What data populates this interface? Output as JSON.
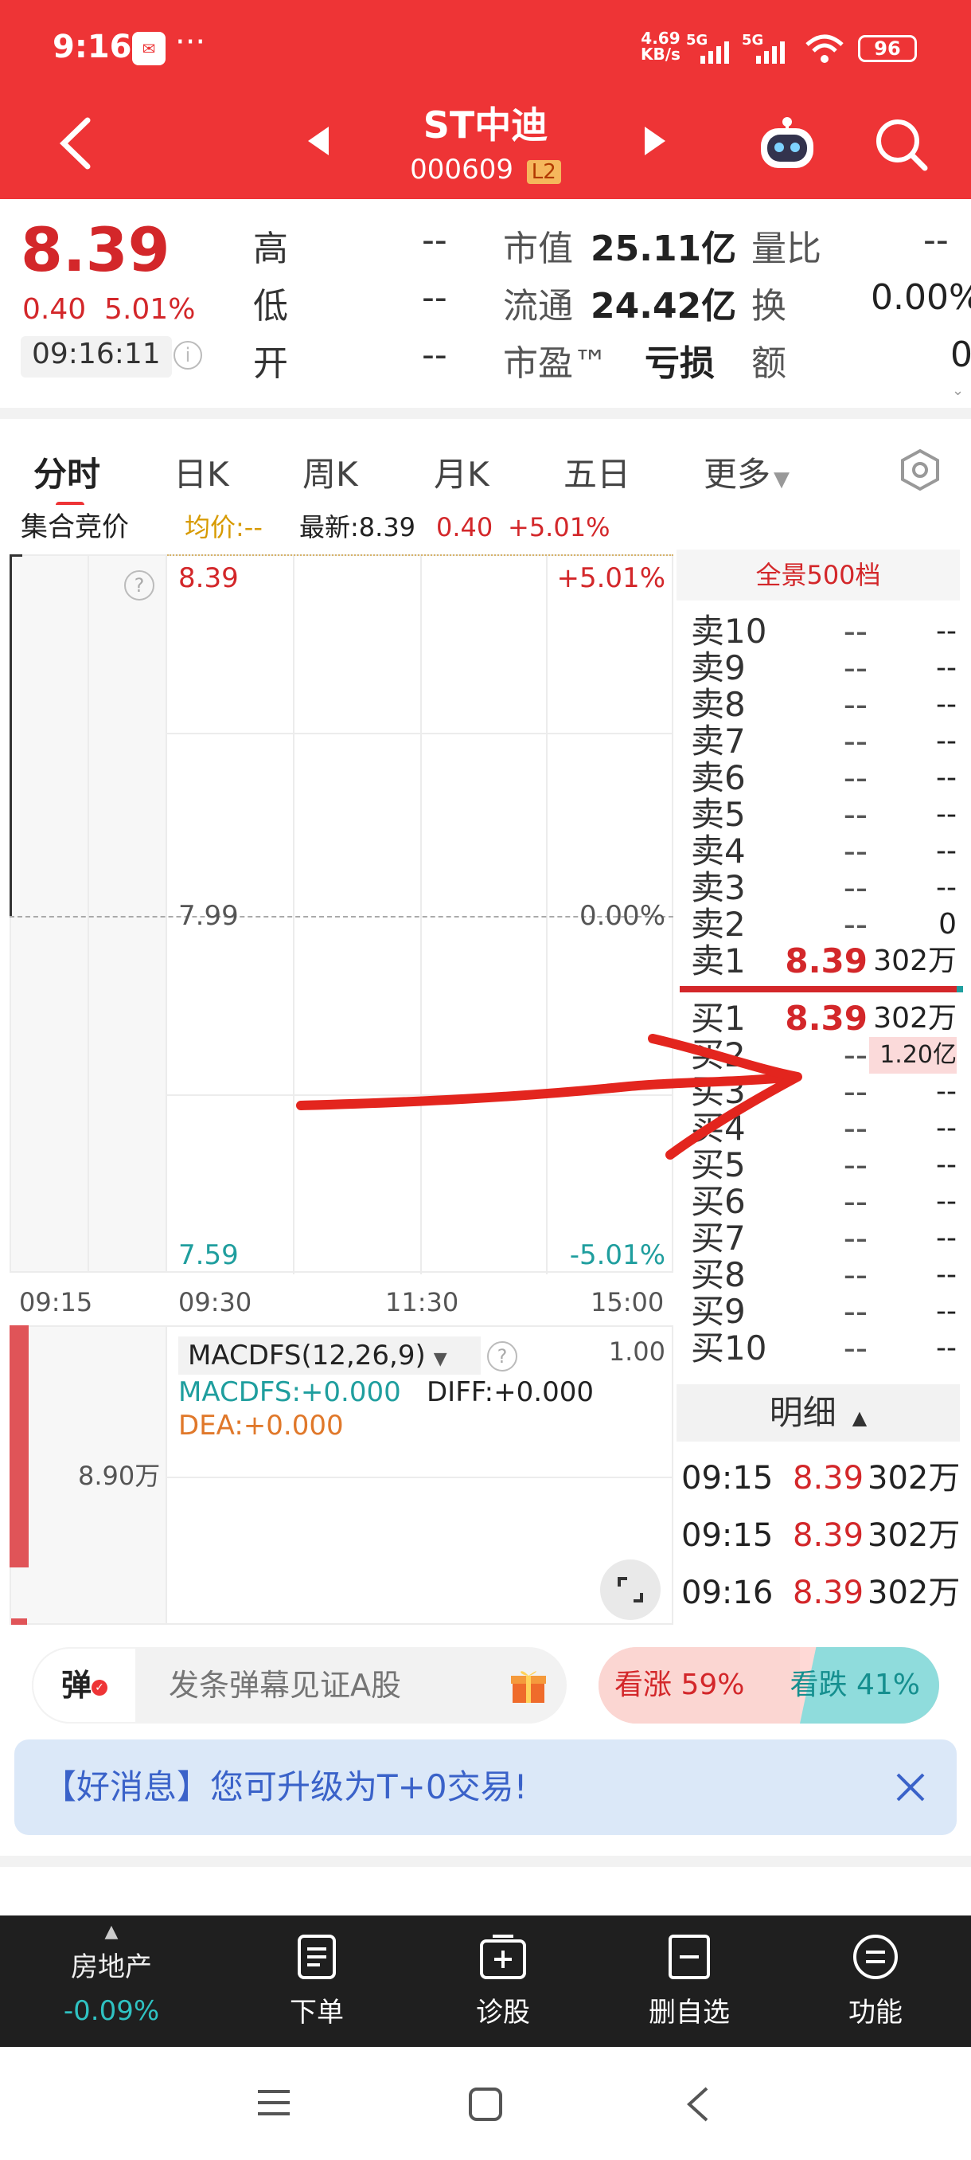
{
  "status_bar": {
    "time": "9:16",
    "dots": "···",
    "net_speed_value": "4.69",
    "net_speed_unit": "KB/s",
    "sig1": "5G",
    "sig2": "5G",
    "battery": "96"
  },
  "header": {
    "stock_name": "ST中迪",
    "stock_code": "000609",
    "level_badge": "L2"
  },
  "quote": {
    "price": "8.39",
    "change": "0.40",
    "change_pct": "5.01%",
    "time": "09:16:11",
    "high_label": "高",
    "high": "--",
    "low_label": "低",
    "low": "--",
    "open_label": "开",
    "open": "--",
    "mktcap_label": "市值",
    "mktcap": "25.11亿",
    "float_label": "流通",
    "float": "24.42亿",
    "pe_label": "市盈™",
    "pe": "亏损",
    "volratio_label": "量比",
    "volratio": "--",
    "turnover_label": "换",
    "turnover": "0.00%",
    "amount_label": "额",
    "amount": "0"
  },
  "tabs": [
    "分时",
    "日K",
    "周K",
    "月K",
    "五日",
    "更多"
  ],
  "info_line": {
    "auction": "集合竞价",
    "avg": "均价:--",
    "latest": "最新:8.39",
    "chg": "0.40",
    "pct": "+5.01%"
  },
  "chart_data": {
    "type": "line",
    "price_top": "8.39",
    "price_mid": "7.99",
    "price_bottom": "7.59",
    "pct_top": "+5.01%",
    "pct_mid": "0.00%",
    "pct_bottom": "-5.01%",
    "x_ticks": [
      "09:15",
      "09:30",
      "11:30",
      "15:00"
    ],
    "series": []
  },
  "macd": {
    "title": "MACDFS(12,26,9)",
    "scale": "1.00",
    "macdfs": "MACDFS:+0.000",
    "diff": "DIFF:+0.000",
    "dea": "DEA:+0.000",
    "vol_label": "8.90万"
  },
  "order_book": {
    "title": "全景500档",
    "asks": [
      {
        "label": "卖10",
        "price": "--",
        "vol": "--"
      },
      {
        "label": "卖9",
        "price": "--",
        "vol": "--"
      },
      {
        "label": "卖8",
        "price": "--",
        "vol": "--"
      },
      {
        "label": "卖7",
        "price": "--",
        "vol": "--"
      },
      {
        "label": "卖6",
        "price": "--",
        "vol": "--"
      },
      {
        "label": "卖5",
        "price": "--",
        "vol": "--"
      },
      {
        "label": "卖4",
        "price": "--",
        "vol": "--"
      },
      {
        "label": "卖3",
        "price": "--",
        "vol": "--"
      },
      {
        "label": "卖2",
        "price": "--",
        "vol": "0"
      },
      {
        "label": "卖1",
        "price": "8.39",
        "vol": "302万"
      }
    ],
    "bids": [
      {
        "label": "买1",
        "price": "8.39",
        "vol": "302万"
      },
      {
        "label": "买2",
        "price": "--",
        "vol": "1.20亿"
      },
      {
        "label": "买3",
        "price": "--",
        "vol": "--"
      },
      {
        "label": "买4",
        "price": "--",
        "vol": "--"
      },
      {
        "label": "买5",
        "price": "--",
        "vol": "--"
      },
      {
        "label": "买6",
        "price": "--",
        "vol": "--"
      },
      {
        "label": "买7",
        "price": "--",
        "vol": "--"
      },
      {
        "label": "买8",
        "price": "--",
        "vol": "--"
      },
      {
        "label": "买9",
        "price": "--",
        "vol": "--"
      },
      {
        "label": "买10",
        "price": "--",
        "vol": "--"
      }
    ],
    "detail_title": "明细",
    "details": [
      {
        "time": "09:15",
        "price": "8.39",
        "vol": "302万"
      },
      {
        "time": "09:15",
        "price": "8.39",
        "vol": "302万"
      },
      {
        "time": "09:16",
        "price": "8.39",
        "vol": "302万"
      }
    ]
  },
  "danmaku": {
    "icon_text": "弹",
    "placeholder": "发条弹幕见证A股",
    "up_label": "看涨 59%",
    "down_label": "看跌 41%",
    "up_pct": 59
  },
  "banner": {
    "text": "【好消息】您可升级为T+0交易!"
  },
  "bottom_nav": {
    "sector_name": "房地产",
    "sector_change": "-0.09%",
    "items": [
      "下单",
      "诊股",
      "删自选",
      "功能"
    ]
  },
  "colors": {
    "brand_red": "#ee3436",
    "up": "#d3272a",
    "down": "#1f9e9e"
  }
}
